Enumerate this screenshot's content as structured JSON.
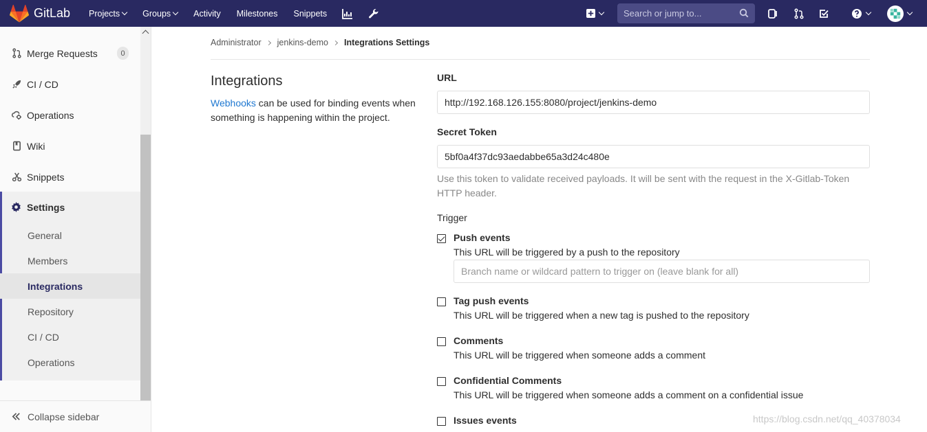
{
  "navbar": {
    "brand": "GitLab",
    "links": [
      {
        "label": "Projects",
        "dropdown": true
      },
      {
        "label": "Groups",
        "dropdown": true
      },
      {
        "label": "Activity",
        "dropdown": false
      },
      {
        "label": "Milestones",
        "dropdown": false
      },
      {
        "label": "Snippets",
        "dropdown": false
      }
    ],
    "search_placeholder": "Search or jump to...",
    "bg_color": "#292961"
  },
  "sidebar": {
    "items": [
      {
        "label": "Merge Requests",
        "icon": "merge-request-icon",
        "badge": "0"
      },
      {
        "label": "CI / CD",
        "icon": "rocket-icon"
      },
      {
        "label": "Operations",
        "icon": "cloud-gear-icon"
      },
      {
        "label": "Wiki",
        "icon": "book-icon"
      },
      {
        "label": "Snippets",
        "icon": "scissors-icon"
      }
    ],
    "settings": {
      "label": "Settings",
      "sub_items": [
        "General",
        "Members",
        "Integrations",
        "Repository",
        "CI / CD",
        "Operations"
      ],
      "active": "Integrations"
    },
    "collapse_label": "Collapse sidebar"
  },
  "breadcrumb": [
    "Administrator",
    "jenkins-demo",
    "Integrations Settings"
  ],
  "intro": {
    "title": "Integrations",
    "link_text": "Webhooks",
    "desc_rest": " can be used for binding events when something is happening within the project."
  },
  "form": {
    "url_label": "URL",
    "url_value": "http://192.168.126.155:8080/project/jenkins-demo",
    "token_label": "Secret Token",
    "token_value": "5bf0a4f37dc93aedabbe65a3d24c480e",
    "token_help": "Use this token to validate received payloads. It will be sent with the request in the X-Gitlab-Token HTTP header.",
    "trigger_label": "Trigger",
    "branch_placeholder": "Branch name or wildcard pattern to trigger on (leave blank for all)",
    "events": [
      {
        "title": "Push events",
        "desc": "This URL will be triggered by a push to the repository",
        "checked": true
      },
      {
        "title": "Tag push events",
        "desc": "This URL will be triggered when a new tag is pushed to the repository",
        "checked": false
      },
      {
        "title": "Comments",
        "desc": "This URL will be triggered when someone adds a comment",
        "checked": false
      },
      {
        "title": "Confidential Comments",
        "desc": "This URL will be triggered when someone adds a comment on a confidential issue",
        "checked": false
      },
      {
        "title": "Issues events",
        "desc": "",
        "checked": false
      }
    ]
  },
  "watermark": "https://blog.csdn.net/qq_40378034"
}
